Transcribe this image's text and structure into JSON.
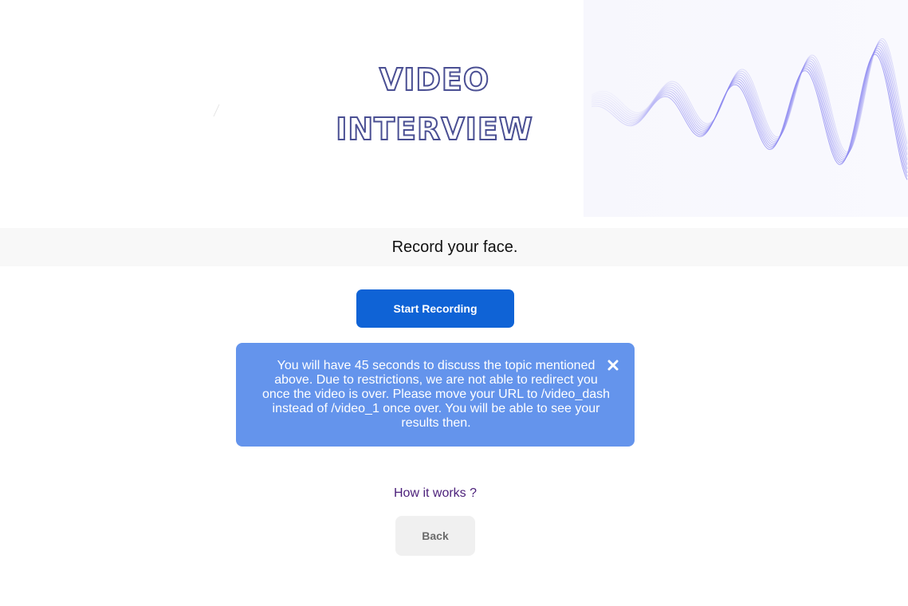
{
  "hero": {
    "title_line1": "VIDEO",
    "title_line2": "INTERVIEW"
  },
  "prompt": {
    "text": "Record your face."
  },
  "actions": {
    "start_recording_label": "Start Recording",
    "back_label": "Back"
  },
  "info": {
    "message": "You will have 45 seconds to discuss the topic mentioned above. Due to restrictions, we are not able to redirect you once the video is over. Please move your URL to /video_dash instead of /video_1 once over. You will be able to see your results then.",
    "close_icon": "close-icon"
  },
  "links": {
    "how_it_works": "How it works ?"
  },
  "colors": {
    "primary_button": "#0f63d6",
    "info_background": "#6494ec",
    "title_stroke": "#4a4f93",
    "link": "#4b1f7a",
    "wave": "#8b86f0"
  }
}
